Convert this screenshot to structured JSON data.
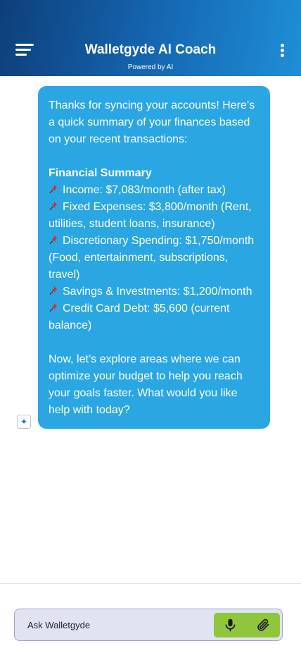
{
  "header": {
    "title": "Walletgyde AI Coach",
    "subtitle": "Powered by AI",
    "menu_icon": "hamburger-menu-icon",
    "more_icon": "kebab-more-icon"
  },
  "message": {
    "intro": "Thanks for syncing your accounts! Here’s a quick summary of your finances based on your recent transactions:",
    "summary_title": "Financial Summary",
    "items": [
      "Income: $7,083/month (after tax)",
      "Fixed Expenses: $3,800/month (Rent, utilities, student loans, insurance)",
      "Discretionary Spending: $1,750/month (Food, entertainment, subscriptions, travel)",
      "Savings & Investments: $1,200/month",
      "Credit Card Debt: $5,600 (current balance)"
    ],
    "outro": "Now, let’s explore areas where we can optimize your budget to help you reach your goals faster. What would you like help with today?",
    "bullet_icon": "pushpin-icon",
    "avatar_icon": "ai-sparkle-icon"
  },
  "composer": {
    "placeholder": "Ask Walletgyde",
    "value": "",
    "mic_icon": "microphone-icon",
    "attach_icon": "paperclip-icon"
  },
  "colors": {
    "header_start": "#0d3f7a",
    "header_end": "#1e8fd6",
    "bubble": "#2aa7e3",
    "composer_bg": "#dfe3f2",
    "action_green": "#8fc63c",
    "pin_red": "#d32f2f"
  }
}
